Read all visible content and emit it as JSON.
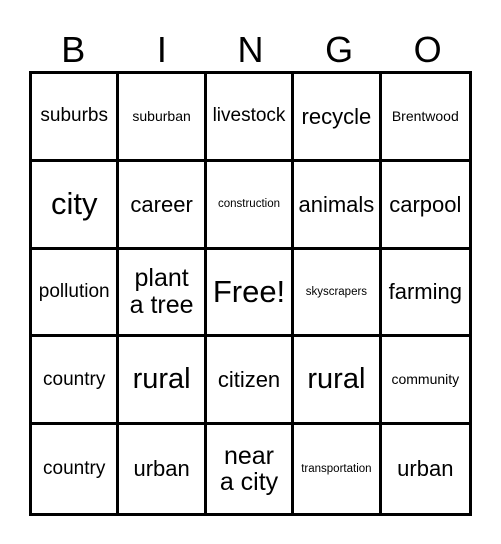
{
  "card": {
    "type": "bingo-card",
    "header_letters": [
      "B",
      "I",
      "N",
      "G",
      "O"
    ],
    "columns": 5,
    "rows": 5,
    "colors": {
      "background": "#ffffff",
      "border": "#000000",
      "text": "#000000"
    },
    "cells": [
      {
        "text": "suburbs",
        "size": "sm",
        "free": false
      },
      {
        "text": "suburban",
        "size": "xs",
        "free": false
      },
      {
        "text": "livestock",
        "size": "sm",
        "free": false
      },
      {
        "text": "recycle",
        "size": "md",
        "free": false
      },
      {
        "text": "Brentwood",
        "size": "xs",
        "free": false
      },
      {
        "text": "city",
        "size": "xxl",
        "free": false
      },
      {
        "text": "career",
        "size": "md",
        "free": false
      },
      {
        "text": "construction",
        "size": "xxs",
        "free": false
      },
      {
        "text": "animals",
        "size": "md",
        "free": false
      },
      {
        "text": "carpool",
        "size": "md",
        "free": false
      },
      {
        "text": "pollution",
        "size": "sm",
        "free": false
      },
      {
        "text": "plant\na tree",
        "size": "lg",
        "free": false
      },
      {
        "text": "Free!",
        "size": "xxl",
        "free": true
      },
      {
        "text": "skyscrapers",
        "size": "xxs",
        "free": false
      },
      {
        "text": "farming",
        "size": "md",
        "free": false
      },
      {
        "text": "country",
        "size": "sm",
        "free": false
      },
      {
        "text": "rural",
        "size": "xl",
        "free": false
      },
      {
        "text": "citizen",
        "size": "md",
        "free": false
      },
      {
        "text": "rural",
        "size": "xl",
        "free": false
      },
      {
        "text": "community",
        "size": "xs",
        "free": false
      },
      {
        "text": "country",
        "size": "sm",
        "free": false
      },
      {
        "text": "urban",
        "size": "md",
        "free": false
      },
      {
        "text": "near\na city",
        "size": "lg",
        "free": false
      },
      {
        "text": "transportation",
        "size": "xxs",
        "free": false
      },
      {
        "text": "urban",
        "size": "md",
        "free": false
      }
    ]
  }
}
